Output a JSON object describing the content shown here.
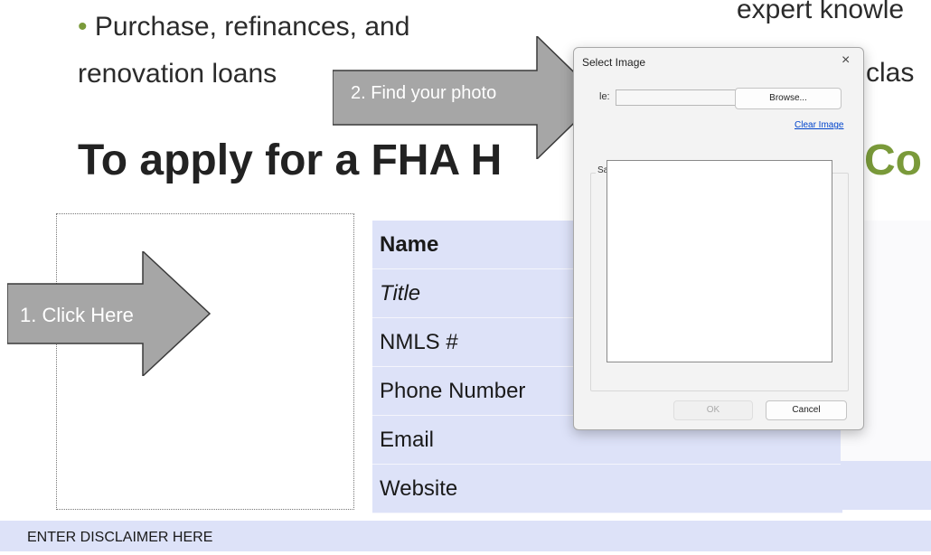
{
  "document": {
    "bullet_mark": "•",
    "bullet_text": "Purchase, refinances, and",
    "bullet_line2": "renovation loans",
    "right_text_1": "expert knowle",
    "right_text_2": "clas",
    "heading": "To apply for a FHA H",
    "heading_right": "Co",
    "info_rows": [
      "Name",
      "Title",
      "NMLS #",
      "Phone Number",
      "Email",
      "Website"
    ],
    "disclaimer": "ENTER DISCLAIMER HERE"
  },
  "annotations": {
    "step1": "1.  Click Here",
    "step2": "2. Find your photo",
    "arrow_color": "#a6a6a6"
  },
  "dialog": {
    "title": "Select Image",
    "close_glyph": "×",
    "file_label": "le:",
    "file_value": "",
    "browse_label": "Browse...",
    "clear_label": "Clear Image",
    "sample_label": "Sample",
    "ok_label": "OK",
    "cancel_label": "Cancel"
  },
  "colors": {
    "accent_green": "#7a9a3a",
    "table_bg": "#dde2f8",
    "link_blue": "#0044cc"
  }
}
